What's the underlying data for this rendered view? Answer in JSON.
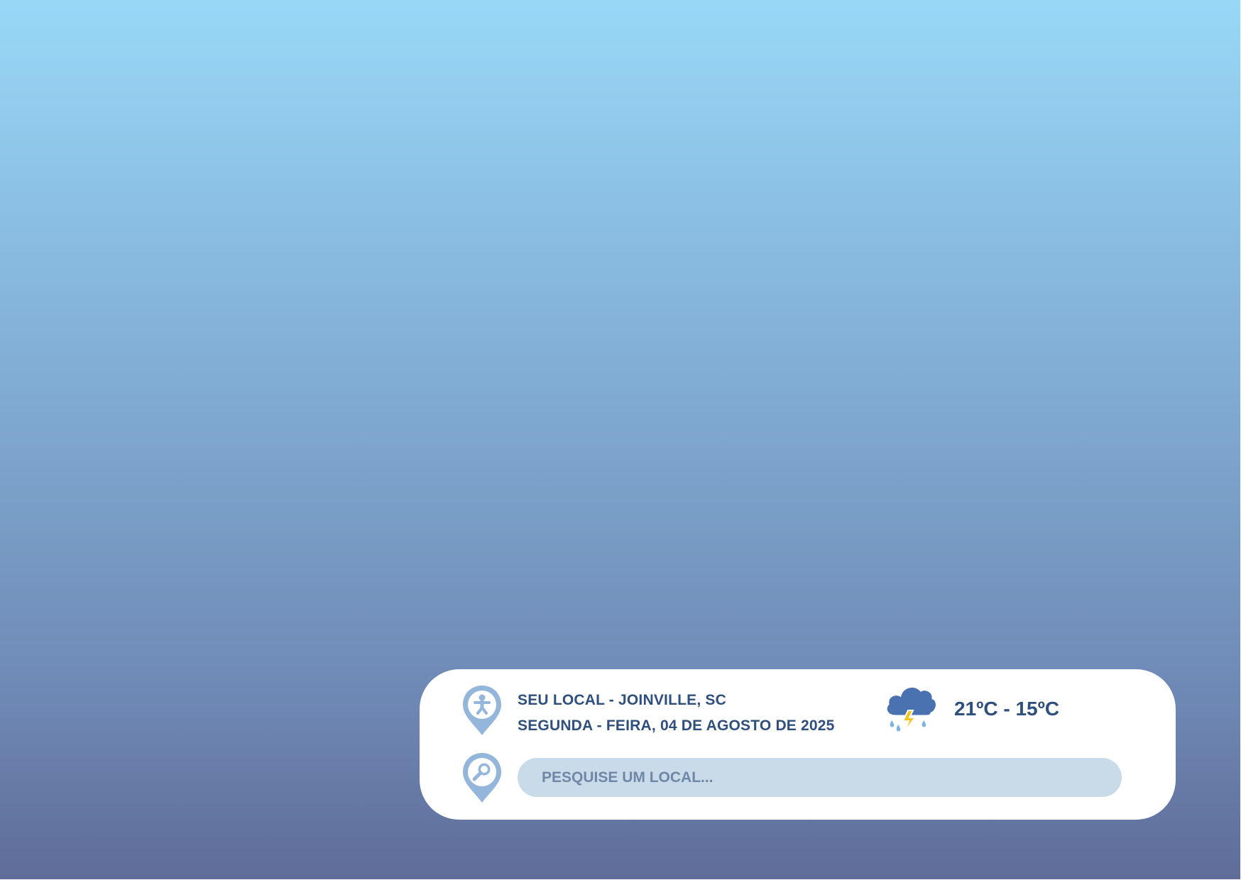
{
  "location": {
    "line1": "SEU LOCAL - JOINVILLE, SC",
    "line2": "SEGUNDA - FEIRA, 04 DE AGOSTO DE 2025",
    "pin_icon": "person-location-pin-icon"
  },
  "weather": {
    "icon": "thunderstorm-rain-icon",
    "temperature_range": "21ºC - 15ºC"
  },
  "search": {
    "placeholder": "PESQUISE UM LOCAL...",
    "value": "",
    "pin_icon": "search-location-pin-icon"
  },
  "colors": {
    "text_primary": "#2f4f7c",
    "pin_fill": "#93b6da",
    "search_bg": "#c9dae8",
    "search_text": "#6f87a8",
    "cloud": "#4a72b0",
    "lightning": "#f2c417",
    "rain": "#7db4e6",
    "sky_top": "#98d8f7",
    "sky_bottom": "#5f6c98"
  }
}
